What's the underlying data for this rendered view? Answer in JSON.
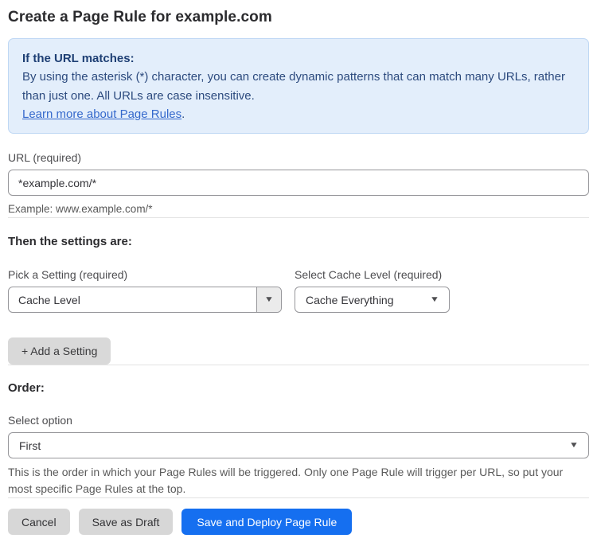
{
  "page": {
    "title": "Create a Page Rule for example.com"
  },
  "info_box": {
    "heading": "If the URL matches:",
    "body": "By using the asterisk (*) character, you can create dynamic patterns that can match many URLs, rather than just one. All URLs are case insensitive.",
    "link_label": "Learn more about Page Rules",
    "link_suffix": "."
  },
  "url_field": {
    "label": "URL (required)",
    "value": "*example.com/*",
    "helper": "Example: www.example.com/*"
  },
  "settings_section": {
    "heading": "Then the settings are:",
    "setting_picker": {
      "label": "Pick a Setting (required)",
      "selected_value": "Cache Level"
    },
    "cache_level_picker": {
      "label": "Select Cache Level (required)",
      "selected_value": "Cache Everything"
    },
    "add_setting_label": "+ Add a Setting"
  },
  "order_section": {
    "heading": "Order:",
    "label": "Select option",
    "selected_value": "First",
    "helper": "This is the order in which your Page Rules will be triggered. Only one Page Rule will trigger per URL, so put your most specific Page Rules at the top."
  },
  "actions": {
    "cancel_label": "Cancel",
    "save_draft_label": "Save as Draft",
    "save_deploy_label": "Save and Deploy Page Rule"
  },
  "icons": {
    "dropdown_arrow": "▼"
  },
  "colors": {
    "primary_button": "#156ff0",
    "info_box_bg": "#e3eefb",
    "info_box_border": "#bed7f4",
    "info_text": "#2c4a7e",
    "link": "#3569cc"
  }
}
